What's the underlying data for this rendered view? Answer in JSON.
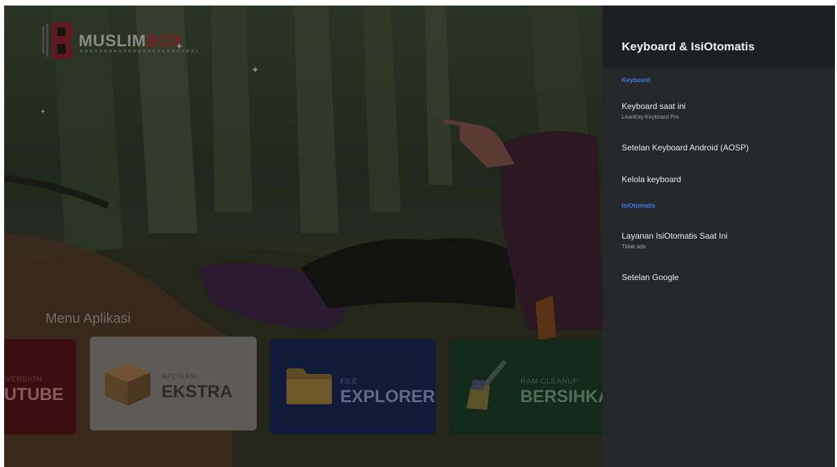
{
  "launcher": {
    "logo_text_main": "MUSLIM",
    "logo_text_accent": "BOX",
    "menu_title": "Menu Aplikasi",
    "tiles": [
      {
        "small": "VERSION",
        "big": "UTUBE",
        "icon": "youtube-tile"
      },
      {
        "small": "APLIKASI",
        "big": "EKSTRA",
        "icon": "box-icon"
      },
      {
        "small": "FILE",
        "big": "EXPLORER",
        "icon": "folder-icon"
      },
      {
        "small": "RAM CLEANUP",
        "big": "BERSIHKAN",
        "icon": "broom-icon"
      }
    ]
  },
  "panel": {
    "title": "Keyboard & IsiOtomatis",
    "sections": [
      {
        "label": "Keyboard",
        "items": [
          {
            "title": "Keyboard saat ini",
            "subtitle": "LeanKey Keyboard Pro"
          },
          {
            "title": "Setelan Keyboard Android (AOSP)",
            "subtitle": ""
          },
          {
            "title": "Kelola keyboard",
            "subtitle": ""
          }
        ]
      },
      {
        "label": "IsiOtomatis",
        "items": [
          {
            "title": "Layanan IsiOtomatis Saat Ini",
            "subtitle": "Tidak ada"
          },
          {
            "title": "Setelan Google",
            "subtitle": ""
          }
        ]
      }
    ]
  },
  "colors": {
    "panel_bg": "#26272a",
    "panel_header_bg": "#1e1f22",
    "section_accent": "#3e7be8",
    "brand_red": "#7a1f24"
  }
}
